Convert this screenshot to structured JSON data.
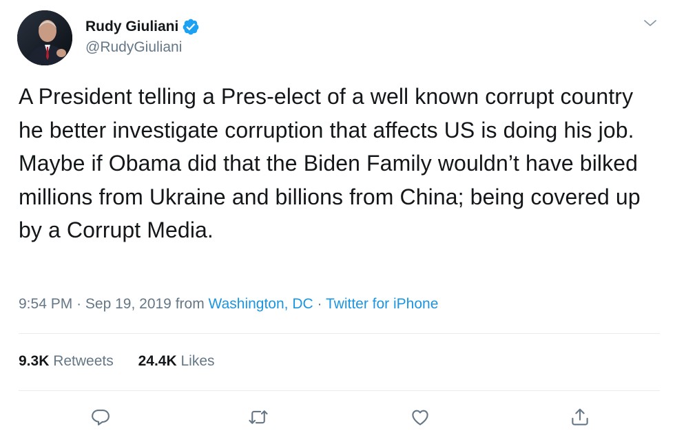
{
  "author": {
    "display_name": "Rudy Giuliani",
    "handle": "@RudyGiuliani",
    "verified": true
  },
  "tweet": {
    "text": "A President telling a Pres-elect of a well known corrupt country he better investigate corruption that affects US is doing his job. Maybe if Obama did that the Biden Family wouldn’t have bilked millions from Ukraine and billions from China; being covered up by a Corrupt Media."
  },
  "meta": {
    "time": "9:54 PM",
    "separator": "·",
    "date": "Sep 19, 2019",
    "from_label": "from",
    "location": "Washington, DC",
    "source": "Twitter for iPhone"
  },
  "stats": {
    "retweets_count": "9.3K",
    "retweets_label": "Retweets",
    "likes_count": "24.4K",
    "likes_label": "Likes"
  },
  "icons": {
    "menu": "chevron-down-icon",
    "verified": "verified-badge-icon",
    "reply": "reply-icon",
    "retweet": "retweet-icon",
    "like": "heart-icon",
    "share": "share-icon"
  },
  "colors": {
    "text": "#14171a",
    "secondary": "#657786",
    "link": "#1b95e0",
    "verified": "#1da1f2",
    "divider": "#e6ecf0"
  }
}
